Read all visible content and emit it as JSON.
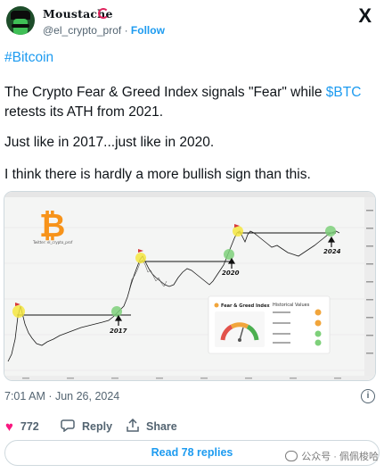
{
  "author": {
    "display_name": "Moustache",
    "handle": "@el_crypto_prof",
    "separator": "·",
    "follow_label": "Follow"
  },
  "platform_logo": "X",
  "tweet": {
    "hashtag": "#Bitcoin",
    "line1": "The Crypto Fear & Greed Index signals \"Fear\" while ",
    "cashtag": "$BTC",
    "line2": "retests its ATH from 2021.",
    "line3": "Just like in 2017...just like in 2020.",
    "line4": "I think there is hardly a more bullish sign than this."
  },
  "media": {
    "watermark_text": "Twitter: el_crypto_prof",
    "year_labels": [
      "2017",
      "2020",
      "2024"
    ],
    "widget_title": "Fear & Greed Index",
    "widget_panel_title": "Historical Values",
    "colors": {
      "price_line": "#1a1a1a",
      "logo": "#f7931a",
      "highlight_yellow": "#f5e640",
      "highlight_green": "#7ed07a",
      "gauge_red": "#e2524b",
      "gauge_orange": "#f1a53b",
      "gauge_green": "#4caf50"
    }
  },
  "meta": {
    "timestamp": "7:01 AM · Jun 26, 2024",
    "info_icon": "info-icon"
  },
  "actions": {
    "like_count": "772",
    "reply_label": "Reply",
    "share_label": "Share"
  },
  "read_replies_label": "Read 78 replies",
  "bottom_watermark": "公众号 · 佩佩梭哈"
}
